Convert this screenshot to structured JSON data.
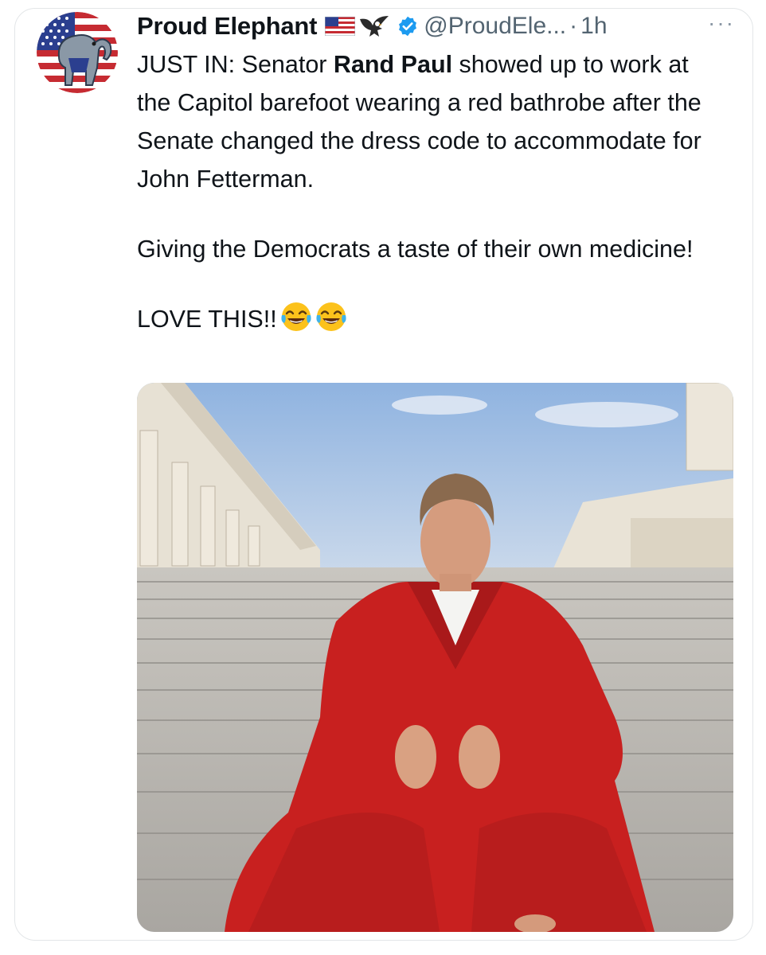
{
  "tweet": {
    "author": {
      "name": "Proud Elephant",
      "handle": "@ProudEle...",
      "name_emoji": [
        "us-flag",
        "eagle"
      ],
      "verified": true
    },
    "separator": "·",
    "time": "1h",
    "more": "···",
    "body": {
      "p1_lead": "JUST IN: Senator ",
      "p1_bold": "Rand Paul",
      "p1_tail": " showed up to work at the Capitol barefoot wearing a red bathrobe after the Senate changed the dress code to accommodate for John Fetterman.",
      "p2": "Giving the Democrats a taste of their own medicine!",
      "p3": "LOVE THIS!!",
      "p3_emoji": [
        "face-with-tears-of-joy",
        "face-with-tears-of-joy"
      ]
    },
    "media": {
      "description_icon": "photo"
    }
  },
  "colors": {
    "text": "#0f1419",
    "secondary": "#536471",
    "verified": "#1d9bf0",
    "card_border": "#e3e6e8",
    "robe_red": "#c8201f"
  }
}
